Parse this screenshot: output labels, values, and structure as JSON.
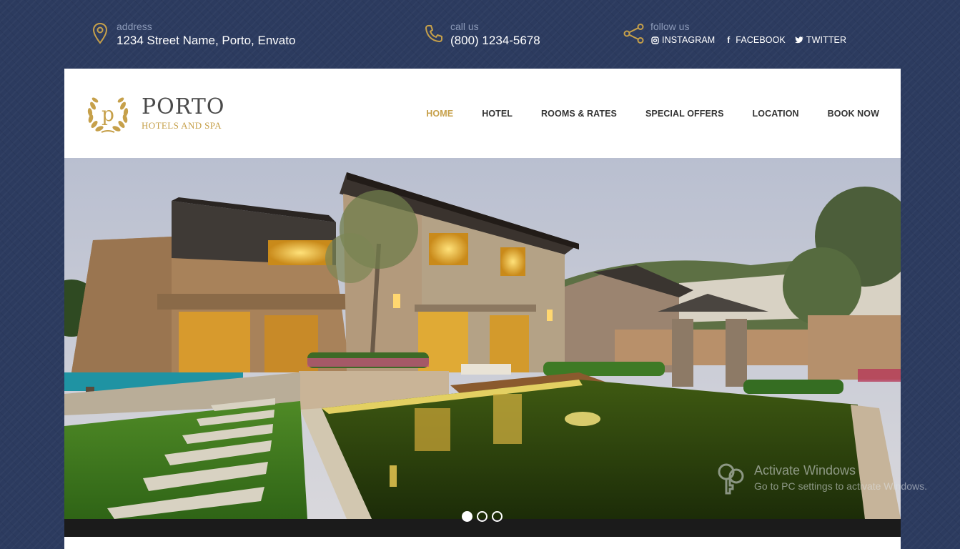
{
  "topbar": {
    "address": {
      "label": "address",
      "value": "1234 Street Name, Porto, Envato",
      "icon": "map-pin-icon"
    },
    "call": {
      "label": "call us",
      "value": "(800) 1234-5678",
      "icon": "phone-icon"
    },
    "follow": {
      "label": "follow us",
      "icon": "share-icon",
      "links": [
        {
          "label": "INSTAGRAM",
          "icon": "instagram-icon"
        },
        {
          "label": "FACEBOOK",
          "icon": "facebook-icon"
        },
        {
          "label": "TWITTER",
          "icon": "twitter-icon"
        }
      ]
    }
  },
  "logo": {
    "name": "PORTO",
    "subtitle": "HOTELS AND SPA",
    "mark_letter": "p",
    "mark_icon": "laurel-wreath-icon"
  },
  "nav": {
    "items": [
      {
        "label": "HOME",
        "active": true
      },
      {
        "label": "HOTEL",
        "active": false
      },
      {
        "label": "ROOMS & RATES",
        "active": false
      },
      {
        "label": "SPECIAL OFFERS",
        "active": false
      },
      {
        "label": "LOCATION",
        "active": false
      },
      {
        "label": "BOOK NOW",
        "active": false
      }
    ]
  },
  "slider": {
    "slide_count": 3,
    "active_index": 0
  },
  "watermark": {
    "title": "Activate Windows",
    "subtitle": "Go to PC settings to activate Windows.",
    "icon": "key-icon"
  },
  "colors": {
    "accent": "#c6a04a",
    "background": "#2c3b5f",
    "nav_text": "#333333",
    "muted_label": "#8c9ab8"
  }
}
